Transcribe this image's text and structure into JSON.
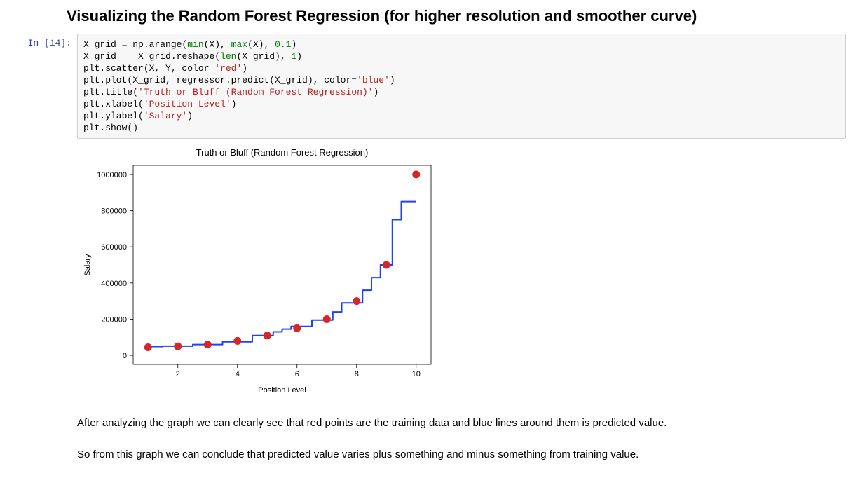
{
  "heading": "Visualizing the Random Forest Regression (for higher resolution and smoother curve)",
  "prompt": "In [14]:",
  "code_tokens": [
    [
      [
        "name",
        "X_grid"
      ],
      [
        "op",
        " = "
      ],
      [
        "name",
        "np.arange("
      ],
      [
        "builtin",
        "min"
      ],
      [
        "name",
        "(X), "
      ],
      [
        "builtin",
        "max"
      ],
      [
        "name",
        "(X), "
      ],
      [
        "num",
        "0.1"
      ],
      [
        "name",
        ")"
      ]
    ],
    [
      [
        "name",
        "X_grid"
      ],
      [
        "op",
        " =  "
      ],
      [
        "name",
        "X_grid.reshape("
      ],
      [
        "builtin",
        "len"
      ],
      [
        "name",
        "(X_grid), "
      ],
      [
        "num",
        "1"
      ],
      [
        "name",
        ")"
      ]
    ],
    [
      [
        "name",
        "plt.scatter(X, Y, color"
      ],
      [
        "op",
        "="
      ],
      [
        "str",
        "'red'"
      ],
      [
        "name",
        ")"
      ]
    ],
    [
      [
        "name",
        "plt.plot(X_grid, regressor.predict(X_grid), color"
      ],
      [
        "op",
        "="
      ],
      [
        "str",
        "'blue'"
      ],
      [
        "name",
        ")"
      ]
    ],
    [
      [
        "name",
        "plt.title("
      ],
      [
        "str",
        "'Truth or Bluff (Random Forest Regression)'"
      ],
      [
        "name",
        ")"
      ]
    ],
    [
      [
        "name",
        "plt.xlabel("
      ],
      [
        "str",
        "'Position Level'"
      ],
      [
        "name",
        ")"
      ]
    ],
    [
      [
        "name",
        "plt.ylabel("
      ],
      [
        "str",
        "'Salary'"
      ],
      [
        "name",
        ")"
      ]
    ],
    [
      [
        "name",
        "plt.show()"
      ]
    ]
  ],
  "chart_data": {
    "type": "scatter+line",
    "title": "Truth or Bluff (Random Forest Regression)",
    "xlabel": "Position Level",
    "ylabel": "Salary",
    "xlim": [
      0.5,
      10.5
    ],
    "ylim": [
      -50000,
      1050000
    ],
    "xticks": [
      2,
      4,
      6,
      8,
      10
    ],
    "yticks": [
      0,
      200000,
      400000,
      600000,
      800000,
      1000000
    ],
    "scatter": {
      "color": "#d62728",
      "points": [
        {
          "x": 1,
          "y": 45000
        },
        {
          "x": 2,
          "y": 50000
        },
        {
          "x": 3,
          "y": 60000
        },
        {
          "x": 4,
          "y": 80000
        },
        {
          "x": 5,
          "y": 110000
        },
        {
          "x": 6,
          "y": 150000
        },
        {
          "x": 7,
          "y": 200000
        },
        {
          "x": 8,
          "y": 300000
        },
        {
          "x": 9,
          "y": 500000
        },
        {
          "x": 10,
          "y": 1000000
        }
      ]
    },
    "line": {
      "color": "#1f3fff",
      "width": 2,
      "points": [
        {
          "x": 1.0,
          "y": 49000
        },
        {
          "x": 1.5,
          "y": 49000
        },
        {
          "x": 1.5,
          "y": 51000
        },
        {
          "x": 2.5,
          "y": 51000
        },
        {
          "x": 2.5,
          "y": 60000
        },
        {
          "x": 3.5,
          "y": 60000
        },
        {
          "x": 3.5,
          "y": 75000
        },
        {
          "x": 4.5,
          "y": 75000
        },
        {
          "x": 4.5,
          "y": 110000
        },
        {
          "x": 5.2,
          "y": 110000
        },
        {
          "x": 5.2,
          "y": 130000
        },
        {
          "x": 5.5,
          "y": 130000
        },
        {
          "x": 5.5,
          "y": 145000
        },
        {
          "x": 5.8,
          "y": 145000
        },
        {
          "x": 5.8,
          "y": 160000
        },
        {
          "x": 6.5,
          "y": 160000
        },
        {
          "x": 6.5,
          "y": 195000
        },
        {
          "x": 7.2,
          "y": 195000
        },
        {
          "x": 7.2,
          "y": 240000
        },
        {
          "x": 7.5,
          "y": 240000
        },
        {
          "x": 7.5,
          "y": 290000
        },
        {
          "x": 8.2,
          "y": 290000
        },
        {
          "x": 8.2,
          "y": 360000
        },
        {
          "x": 8.5,
          "y": 360000
        },
        {
          "x": 8.5,
          "y": 430000
        },
        {
          "x": 8.8,
          "y": 430000
        },
        {
          "x": 8.8,
          "y": 500000
        },
        {
          "x": 9.2,
          "y": 500000
        },
        {
          "x": 9.2,
          "y": 750000
        },
        {
          "x": 9.5,
          "y": 750000
        },
        {
          "x": 9.5,
          "y": 850000
        },
        {
          "x": 10.0,
          "y": 850000
        }
      ]
    }
  },
  "prose": {
    "p1": "After analyzing the graph we can clearly see that red points are the training data and blue lines around them is predicted value.",
    "p2": "So from this graph we can conclude that predicted value varies plus something and minus something from training value."
  }
}
